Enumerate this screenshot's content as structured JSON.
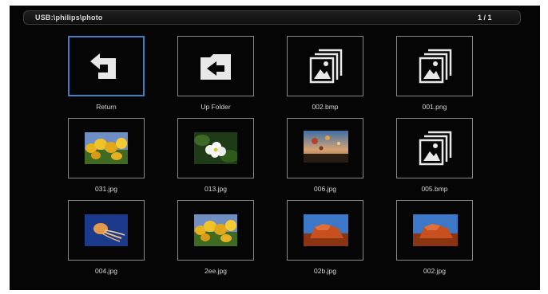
{
  "header": {
    "path": "USB:\\philips\\photo",
    "page_indicator": "1 / 1"
  },
  "tiles": [
    {
      "label": "Return",
      "icon": "return-icon",
      "selected": true
    },
    {
      "label": "Up Folder",
      "icon": "folder-up-icon"
    },
    {
      "label": "002.bmp",
      "icon": "image-placeholder-icon"
    },
    {
      "label": "001.png",
      "icon": "image-placeholder-icon"
    },
    {
      "label": "031.jpg",
      "icon": "tulips-thumbnail"
    },
    {
      "label": "013.jpg",
      "icon": "white-flower-thumbnail"
    },
    {
      "label": "006.jpg",
      "icon": "hot-air-balloons-thumbnail"
    },
    {
      "label": "005.bmp",
      "icon": "image-placeholder-icon"
    },
    {
      "label": "004.jpg",
      "icon": "jellyfish-thumbnail"
    },
    {
      "label": "2ee.jpg",
      "icon": "tulips-thumbnail"
    },
    {
      "label": "02b.jpg",
      "icon": "desert-rock-thumbnail"
    },
    {
      "label": "002.jpg",
      "icon": "desert-rock-thumbnail"
    }
  ],
  "colors": {
    "selection": "#3f7fc2",
    "tile_border": "#8a8a8a",
    "background": "#050505"
  }
}
